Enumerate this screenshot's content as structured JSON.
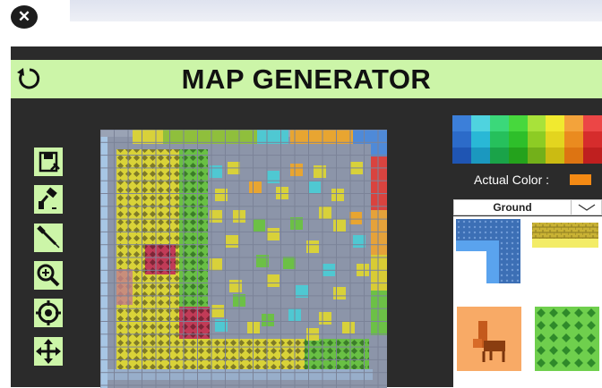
{
  "window": {
    "close_icon": "close-icon"
  },
  "header": {
    "title": "MAP GENERATOR",
    "refresh_icon": "refresh-icon"
  },
  "toolbar": {
    "tools": [
      {
        "name": "save-tool",
        "icon": "save-icon"
      },
      {
        "name": "paint-tool",
        "icon": "paint-roller-icon"
      },
      {
        "name": "eyedropper-tool",
        "icon": "eyedropper-icon"
      },
      {
        "name": "zoom-tool",
        "icon": "zoom-in-icon"
      },
      {
        "name": "target-tool",
        "icon": "crosshair-icon"
      },
      {
        "name": "move-tool",
        "icon": "move-arrows-icon"
      }
    ]
  },
  "palette": {
    "colors": [
      [
        "#3c7fd9",
        "#4fd3df",
        "#3bd87a",
        "#47d83d",
        "#a8e23a",
        "#f1ea2f",
        "#f3a33b",
        "#ec4646"
      ],
      [
        "#2c6bc9",
        "#29b8d6",
        "#26c05c",
        "#2ebf2a",
        "#8dcc24",
        "#e3d51f",
        "#ea8b1f",
        "#d62c2c"
      ],
      [
        "#1f55b3",
        "#1b98bf",
        "#1aa349",
        "#24a21c",
        "#73b01a",
        "#cbbb12",
        "#dd7412",
        "#bf1f1f"
      ]
    ]
  },
  "actual_color": {
    "label": "Actual Color :",
    "value": "#f48a14"
  },
  "layer_select": {
    "value": "Ground",
    "icon": "chevron-down-icon"
  },
  "tiles": [
    {
      "name": "tile-blue-corner",
      "icon": "blue-corner-tile"
    },
    {
      "name": "tile-yellow-brick",
      "icon": "yellow-brick-tile"
    },
    {
      "name": "tile-chair",
      "icon": "chair-tile"
    },
    {
      "name": "tile-green-diamond",
      "icon": "green-diamond-tile"
    }
  ]
}
